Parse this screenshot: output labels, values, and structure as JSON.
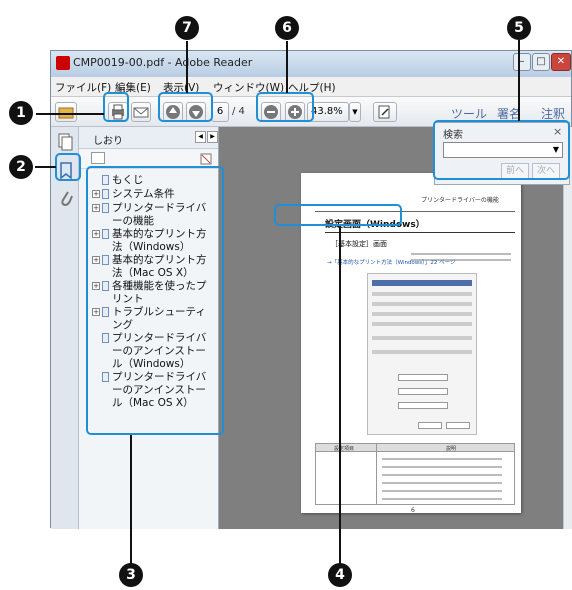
{
  "window": {
    "title": "CMP0019-00.pdf - Adobe Reader",
    "controls": {
      "min": "–",
      "max": "□",
      "close": "✕"
    }
  },
  "menu": {
    "file": "ファイル(F)",
    "edit": "編集(E)",
    "view": "表示(V)",
    "window": "ウィンドウ(W)",
    "help": "ヘルプ(H)"
  },
  "toolbar": {
    "page_current": "6",
    "page_total": "/ 4",
    "zoom": "43.8%",
    "tools": "ツール",
    "sign": "署名",
    "comment": "注釈"
  },
  "bookmarks_panel": {
    "title": "しおり",
    "items": [
      {
        "label": "もくじ",
        "expander": ""
      },
      {
        "label": "システム条件",
        "expander": "+"
      },
      {
        "label": "プリンタードライバ\nーの機能",
        "expander": "+"
      },
      {
        "label": "基本的なプリント方\n法（Windows）",
        "expander": "+"
      },
      {
        "label": "基本的なプリント方\n法（Mac OS X）",
        "expander": "+"
      },
      {
        "label": "各種機能を使ったプ\nリント",
        "expander": "+"
      },
      {
        "label": "トラブルシューティ\nング",
        "expander": "+"
      },
      {
        "label": "プリンタードライバ\nーのアンインストー\nル（Windows）",
        "expander": ""
      },
      {
        "label": "プリンタードライバ\nーのアンインストー\nル（Mac OS X）",
        "expander": ""
      }
    ]
  },
  "search_panel": {
    "title": "検索",
    "close": "×",
    "prev": "前へ",
    "next": "次へ"
  },
  "document_page": {
    "header_right": "プリンタードライバーの機能",
    "heading": "設定画面（Windows）",
    "subheading": "［基本設定］画面",
    "link": "→「基本的なプリント方法（Windows）」22 ページ",
    "table_header_left": "設定項目",
    "table_header_right": "説明",
    "page_number": "6"
  },
  "callouts": {
    "c1": "1",
    "c2": "2",
    "c3": "3",
    "c4": "4",
    "c5": "5",
    "c6": "6",
    "c7": "7"
  }
}
